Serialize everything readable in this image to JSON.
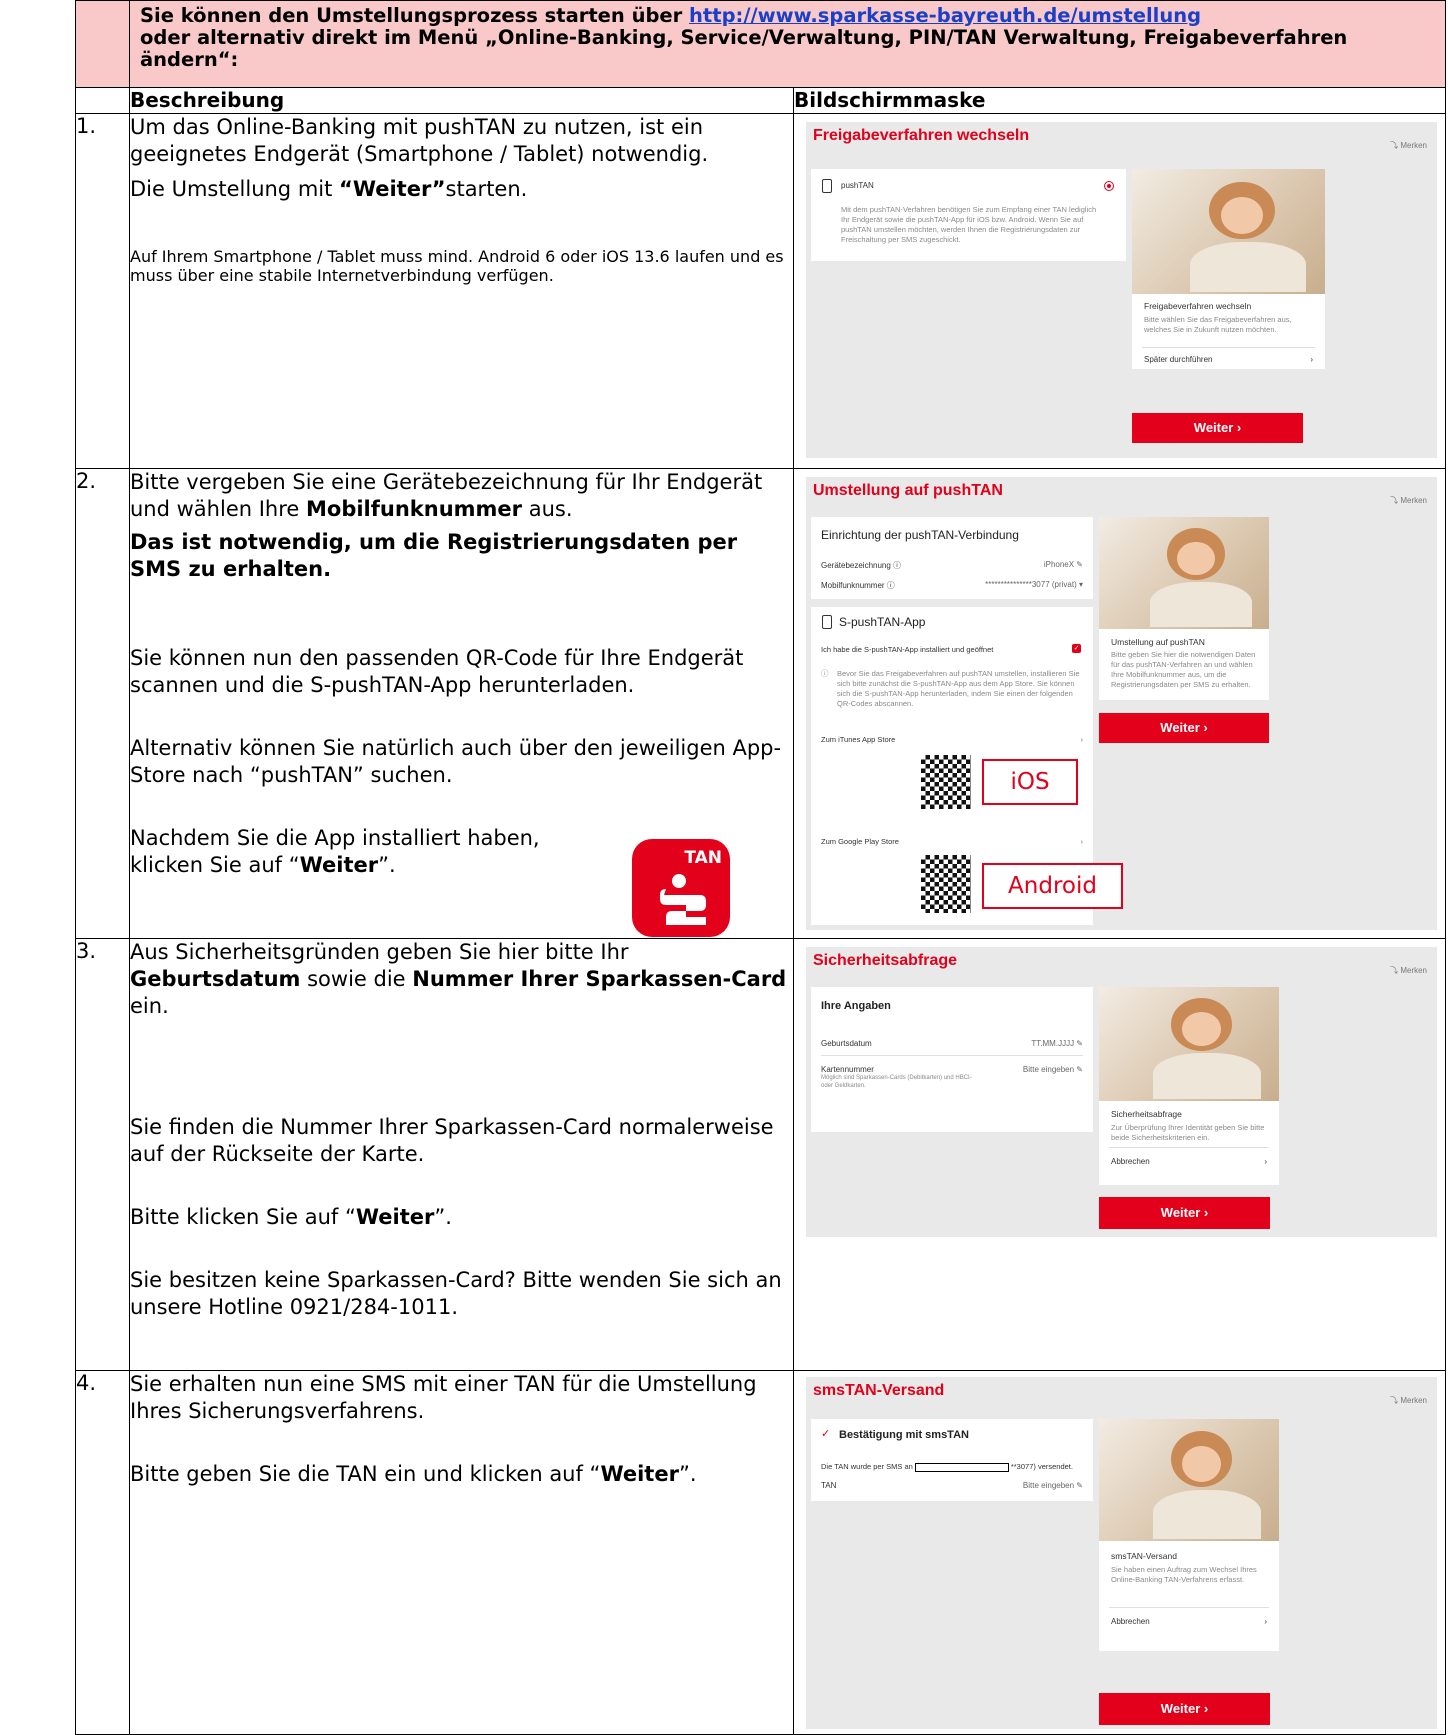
{
  "header": {
    "line1_prefix": "Sie können den Umstellungsprozess starten über ",
    "link": "http://www.sparkasse-bayreuth.de/umstellung",
    "line2": "oder alternativ direkt im Menü „Online-Banking, Service/Verwaltung, PIN/TAN Verwaltung, Freigabeverfahren ändern“:"
  },
  "columns": {
    "beschreibung": "Beschreibung",
    "bildschirmmaske": "Bildschirmmaske"
  },
  "step1": {
    "num": "1.",
    "p1": "Um das Online-Banking mit pushTAN zu nutzen, ist ein geeignetes Endgerät (Smartphone / Tablet) notwendig.",
    "p2_prefix": "Die Umstellung mit ",
    "p2_bold": "“Weiter”",
    "p2_suffix": "starten.",
    "p3": "Auf Ihrem Smartphone / Tablet muss mind. Android 6 oder iOS 13.6 laufen und es muss über eine stabile Internetverbindung verfügen.",
    "shot": {
      "title": "Freigabeverfahren wechseln",
      "merken": "Merken",
      "option": "pushTAN",
      "option_text": "Mit dem pushTAN-Verfahren benötigen Sie zum Empfang einer TAN lediglich Ihr Endgerät sowie die pushTAN-App für iOS bzw. Android. Wenn Sie auf pushTAN umstellen möchten, werden Ihnen die Registrierungsdaten zur Freischaltung per SMS zugeschickt.",
      "side_title": "Freigabeverfahren wechseln",
      "side_text": "Bitte wählen Sie das Freigabeverfahren aus, welches Sie in Zukunft nutzen möchten.",
      "side_link": "Später durchführen",
      "button": "Weiter ›"
    }
  },
  "step2": {
    "num": "2.",
    "p1_prefix": "Bitte vergeben Sie eine Gerätebezeichnung für Ihr Endgerät und wählen Ihre ",
    "p1_bold": "Mobilfunknummer",
    "p1_suffix": " aus.",
    "p2": "Das ist notwendig, um die Registrierungsdaten per SMS zu erhalten.",
    "p3": "Sie können nun den passenden QR-Code für Ihre Endgerät scannen und die S-pushTAN-App herunterladen.",
    "p4": "Alternativ können Sie natürlich auch über den jeweiligen App-Store nach “pushTAN” suchen.",
    "p5_prefix": "Nachdem Sie die App installiert haben, klicken Sie auf “",
    "p5_bold": "Weiter",
    "p5_suffix": "”.",
    "app_icon_text": "TAN",
    "shot": {
      "title": "Umstellung auf pushTAN",
      "merken": "Merken",
      "card1_title": "Einrichtung der pushTAN-Verbindung",
      "row1_label": "Gerätebezeichnung ⓘ",
      "row1_value": "iPhoneX ✎",
      "row2_label": "Mobilfunknummer ⓘ",
      "row2_value": "***************3077 (privat) ▾",
      "card2_title": "S-pushTAN-App",
      "check_label": "Ich habe die S-pushTAN-App installiert und geöffnet",
      "info_text": "Bevor Sie das Freigabeverfahren auf pushTAN umstellen, installieren Sie sich bitte zunächst die S-pushTAN-App aus dem App Store. Sie können sich die S-pushTAN-App herunterladen, indem Sie einen der folgenden QR-Codes abscannen.",
      "itunes": "Zum iTunes App Store",
      "google": "Zum Google Play Store",
      "ios_label": "iOS",
      "android_label": "Android",
      "side_title": "Umstellung auf pushTAN",
      "side_text": "Bitte geben Sie hier die notwendigen Daten für das pushTAN-Verfahren an und wählen Ihre Mobilfunknummer aus, um die Registrierungsdaten per SMS zu erhalten.",
      "button": "Weiter ›"
    }
  },
  "step3": {
    "num": "3.",
    "p1_prefix": "Aus Sicherheitsgründen geben Sie hier bitte Ihr ",
    "p1_bold1": "Geburtsdatum",
    "p1_mid": " sowie die ",
    "p1_bold2": "Nummer Ihrer Sparkassen-Card",
    "p1_suffix": " ein.",
    "p2": "Sie finden die Nummer Ihrer Sparkassen-Card normalerweise auf der Rückseite der Karte.",
    "p3_prefix": "Bitte klicken Sie auf “",
    "p3_bold": "Weiter",
    "p3_suffix": "”.",
    "p4": "Sie besitzen keine Sparkassen-Card? Bitte wenden Sie sich an unsere Hotline 0921/284-1011.",
    "shot": {
      "title": "Sicherheitsabfrage",
      "merken": "Merken",
      "card_title": "Ihre Angaben",
      "row1_label": "Geburtsdatum",
      "row1_value": "TT.MM.JJJJ ✎",
      "row2_label": "Kartennummer",
      "row2_sub": "Möglich sind Sparkassen-Cards (Debitkarten) und HBCI- oder Geldkarten.",
      "row2_value": "Bitte eingeben ✎",
      "side_title": "Sicherheitsabfrage",
      "side_text": "Zur Überprüfung Ihrer Identität geben Sie bitte beide Sicherheitskriterien ein.",
      "side_link": "Abbrechen",
      "button": "Weiter ›"
    }
  },
  "step4": {
    "num": "4.",
    "p1": "Sie erhalten nun eine SMS mit einer TAN für die Umstellung Ihres Sicherungsverfahrens.",
    "p2_prefix": "Bitte geben Sie die TAN ein und klicken auf “",
    "p2_bold": "Weiter",
    "p2_suffix": "”.",
    "shot": {
      "title": "smsTAN-Versand",
      "merken": "Merken",
      "card_title": "Bestätigung mit smsTAN",
      "sent_prefix": "Die TAN wurde per SMS an",
      "sent_suffix": "**3077) versendet.",
      "tan_label": "TAN",
      "tan_value": "Bitte eingeben ✎",
      "side_title": "smsTAN-Versand",
      "side_text": "Sie haben einen Auftrag zum Wechsel Ihres Online-Banking TAN-Verfahrens erfasst.",
      "side_link": "Abbrechen",
      "button": "Weiter ›"
    }
  }
}
